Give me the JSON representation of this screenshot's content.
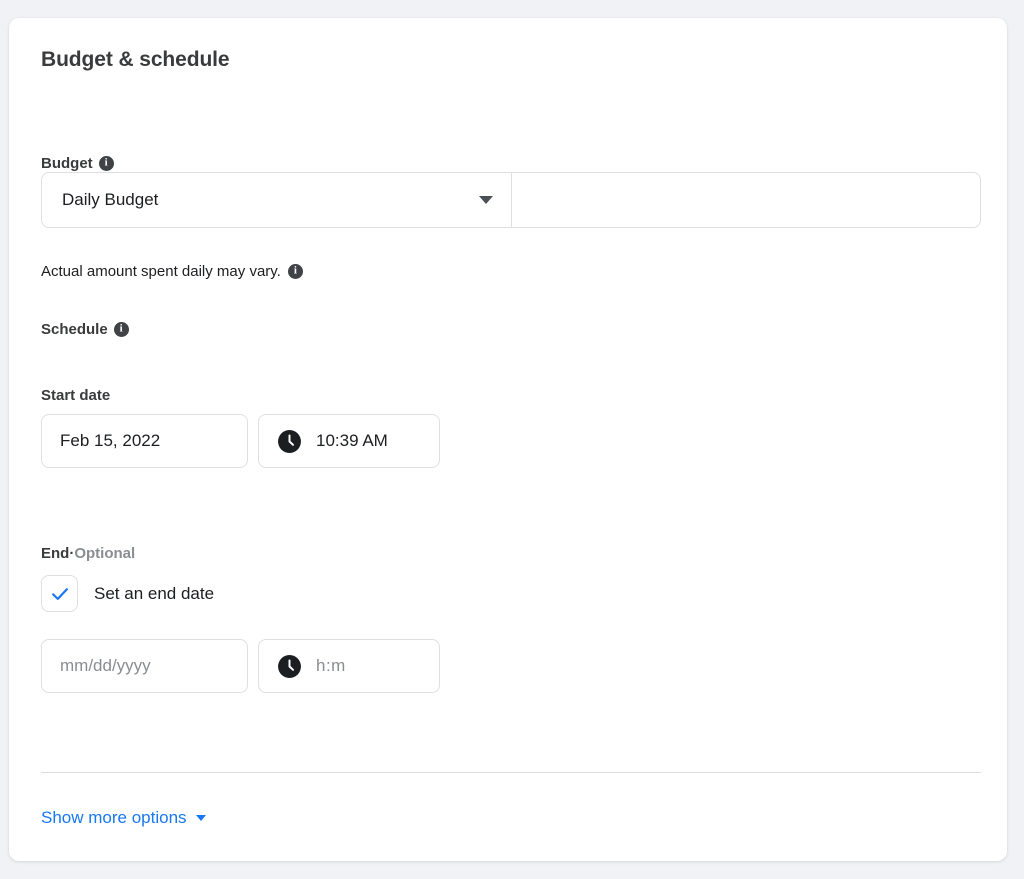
{
  "card": {
    "title": "Budget & schedule"
  },
  "budget": {
    "label": "Budget",
    "info_icon": "info-icon",
    "type_select": {
      "value": "Daily Budget",
      "caret_icon": "chevron-down-icon"
    },
    "amount": {
      "value": "",
      "placeholder": ""
    },
    "helper_text": "Actual amount spent daily may vary.",
    "helper_info_icon": "info-icon"
  },
  "schedule": {
    "label": "Schedule",
    "info_icon": "info-icon",
    "start": {
      "label": "Start date",
      "date_value": "Feb 15, 2022",
      "date_placeholder": "mm/dd/yyyy",
      "time_value": "10:39 AM",
      "clock_icon": "clock-icon"
    },
    "end": {
      "label": "End",
      "separator": "·",
      "optional": "Optional",
      "checkbox_label": "Set an end date",
      "checkbox_checked": true,
      "check_icon": "check-icon",
      "date_value": "",
      "date_placeholder": "mm/dd/yyyy",
      "time_value": "",
      "time_placeholder": "h:m",
      "clock_icon": "clock-icon"
    }
  },
  "footer": {
    "show_more_label": "Show more options",
    "caret_icon": "chevron-down-icon"
  },
  "colors": {
    "accent_blue": "#1877f2",
    "text_primary": "#1c1e21",
    "text_secondary": "#8a8d91",
    "border": "#dddfe2",
    "page_background": "#f0f2f5"
  }
}
